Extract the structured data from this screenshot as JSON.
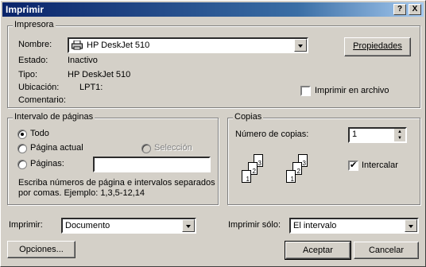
{
  "window": {
    "title": "Imprimir",
    "help_btn": "?",
    "close_btn": "X"
  },
  "printer": {
    "group_label": "Impresora",
    "name_label": "Nombre:",
    "name_value": "HP DeskJet 510",
    "properties_btn": "Propiedades",
    "status_label": "Estado:",
    "status_value": "Inactivo",
    "type_label": "Tipo:",
    "type_value": "HP DeskJet 510",
    "location_label": "Ubicación:",
    "location_value": "LPT1:",
    "comment_label": "Comentario:",
    "print_to_file": "Imprimir en archivo"
  },
  "range": {
    "group_label": "Intervalo de páginas",
    "all": "Todo",
    "current": "Página actual",
    "selection": "Selección",
    "pages": "Páginas:",
    "pages_value": "",
    "hint_line1": "Escriba números de página e intervalos separados",
    "hint_line2": "por comas. Ejemplo: 1,3,5-12,14"
  },
  "copies": {
    "group_label": "Copias",
    "count_label": "Número de copias:",
    "count_value": "1",
    "collate": "Intercalar",
    "collate_checked": true,
    "page_numbers": [
      "1",
      "2",
      "3"
    ]
  },
  "bottom": {
    "print_label": "Imprimir:",
    "print_value": "Documento",
    "print_only_label": "Imprimir sólo:",
    "print_only_value": "El intervalo",
    "options_btn": "Opciones...",
    "accept_btn": "Aceptar",
    "cancel_btn": "Cancelar"
  }
}
